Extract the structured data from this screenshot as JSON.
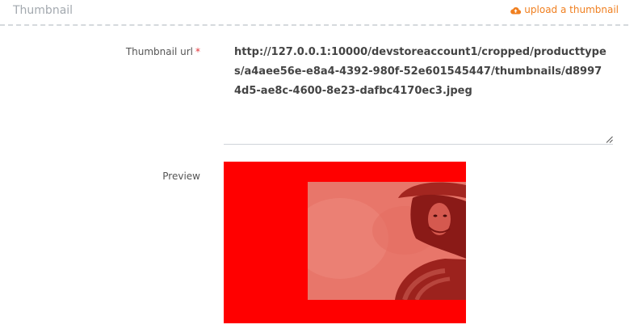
{
  "section": {
    "title": "Thumbnail",
    "upload_label": "upload a thumbnail",
    "upload_icon": "cloud-upload-icon"
  },
  "form": {
    "thumbnail_url_label": "Thumbnail url",
    "required_marker": "*",
    "thumbnail_url_value": "http://127.0.0.1:10000/devstoreaccount1/cropped/producttypes/a4aee56e-e8a4-4392-980f-52e601545447/thumbnails/d89974d5-ae8c-4600-8e23-dafbc4170ec3.jpeg",
    "preview_label": "Preview"
  },
  "colors": {
    "accent": "#f07f1f",
    "required": "#e2353a",
    "preview_background": "#ff0000",
    "header_text": "#a3a9af"
  }
}
